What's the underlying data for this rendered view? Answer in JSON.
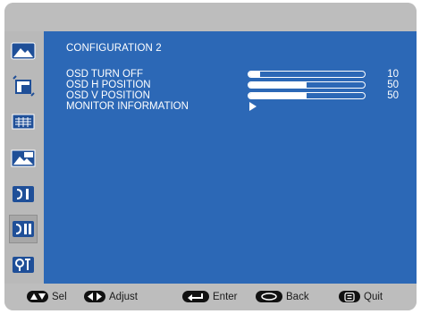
{
  "menu": {
    "title": "CONFIGURATION 2",
    "items": [
      {
        "label": "OSD TURN OFF",
        "value": "10",
        "level": 0.1
      },
      {
        "label": "OSD H POSITION",
        "value": "50",
        "level": 0.5
      },
      {
        "label": "OSD V POSITION",
        "value": "50",
        "level": 0.5
      },
      {
        "label": "MONITOR INFORMATION",
        "value": "",
        "submenu_icon": "play-arrow-icon"
      }
    ]
  },
  "sidebar": {
    "icons": [
      "picture-icon",
      "pip-icon",
      "audio-icon",
      "schedule-icon",
      "configuration-1-icon",
      "configuration-2-icon",
      "advanced-icon"
    ],
    "active": "configuration-2-icon"
  },
  "footer": {
    "hints": [
      {
        "key_icon": "up-down-icon",
        "label": "Sel"
      },
      {
        "key_icon": "left-right-icon",
        "label": "Adjust"
      },
      {
        "key_icon": "enter-icon",
        "label": "Enter"
      },
      {
        "key_icon": "back-icon",
        "label": "Back"
      },
      {
        "key_icon": "menu-icon",
        "label": "Quit"
      }
    ]
  },
  "colors": {
    "panel_blue": "#2c68b6",
    "frame_gray": "#bdbdbd",
    "text_white": "#ffffff"
  }
}
